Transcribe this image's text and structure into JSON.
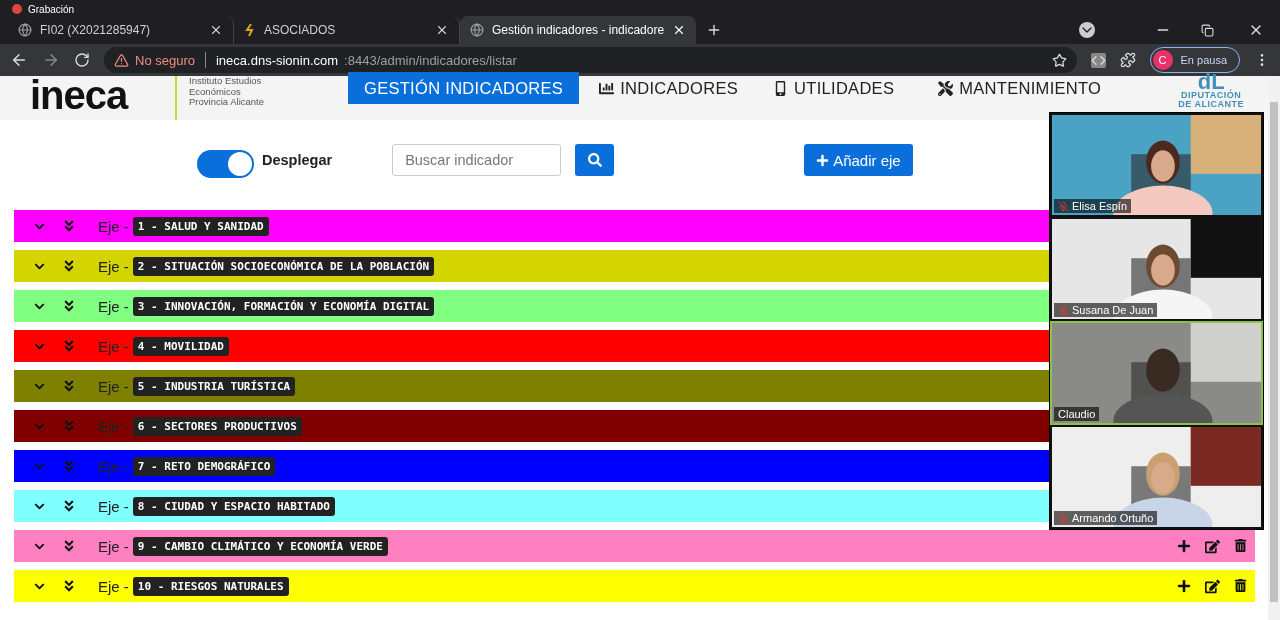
{
  "recording": {
    "label": "Grabación"
  },
  "tabs": [
    {
      "title": "FI02 (X2021285947)",
      "selected": false
    },
    {
      "title": "ASOCIADOS",
      "selected": false
    },
    {
      "title": "Gestión indicadores - indicadore",
      "selected": true
    }
  ],
  "address_bar": {
    "security": "No seguro",
    "host": "ineca.dns-sionin.com",
    "path": ":8443/admin/indicadores/listar"
  },
  "profile": {
    "initial": "C",
    "status": "En pausa"
  },
  "header": {
    "logo": "ineca",
    "tagline": [
      "Instituto Estudios",
      "Económicos",
      "Provincia Alicante"
    ],
    "nav": [
      {
        "label": "GESTIÓN INDICADORES",
        "selected": true
      },
      {
        "label": "INDICADORES",
        "selected": false
      },
      {
        "label": "UTILIDADES",
        "selected": false
      },
      {
        "label": "MANTENIMIENTO",
        "selected": false
      }
    ],
    "partner_logo": {
      "mark": "dL",
      "lines": [
        "DIPUTACIÓN",
        "DE ALICANTE"
      ]
    }
  },
  "toolbar": {
    "toggle": {
      "label": "Desplegar",
      "on": true
    },
    "search": {
      "placeholder": "Buscar indicador"
    },
    "add_button": "Añadir eje"
  },
  "axes": [
    {
      "prefix": "Eje -",
      "title": "1 - SALUD Y SANIDAD",
      "color": "#ff00ff"
    },
    {
      "prefix": "Eje -",
      "title": "2 - SITUACIÓN SOCIOECONÓMICA DE LA POBLACIÓN",
      "color": "#d4d400"
    },
    {
      "prefix": "Eje -",
      "title": "3 - INNOVACIÓN, FORMACIÓN Y ECONOMÍA DIGITAL",
      "color": "#80ff80"
    },
    {
      "prefix": "Eje -",
      "title": "4 - MOVILIDAD",
      "color": "#ff0000"
    },
    {
      "prefix": "Eje -",
      "title": "5 - INDUSTRIA TURÍSTICA",
      "color": "#808000"
    },
    {
      "prefix": "Eje -",
      "title": "6 - SECTORES PRODUCTIVOS",
      "color": "#800000"
    },
    {
      "prefix": "Eje -",
      "title": "7 - RETO DEMOGRÁFICO",
      "color": "#0000ff"
    },
    {
      "prefix": "Eje -",
      "title": "8 - CIUDAD Y ESPACIO HABITADO",
      "color": "#80ffff"
    },
    {
      "prefix": "Eje -",
      "title": "9 - CAMBIO CLIMÁTICO Y ECONOMÍA VERDE",
      "color": "#ff80c0"
    },
    {
      "prefix": "Eje -",
      "title": "10 - RIESGOS NATURALES",
      "color": "#ffff00"
    }
  ],
  "video_call": [
    {
      "name": "Elisa Espín",
      "muted": true,
      "speaking": false,
      "kind": "picture"
    },
    {
      "name": "Susana De Juan",
      "muted": true,
      "speaking": false,
      "kind": "picture"
    },
    {
      "name": "Claudio",
      "muted": false,
      "speaking": true,
      "kind": "picture"
    },
    {
      "name": "Armando Ortuño",
      "muted": true,
      "speaking": false,
      "kind": "picture"
    }
  ]
}
